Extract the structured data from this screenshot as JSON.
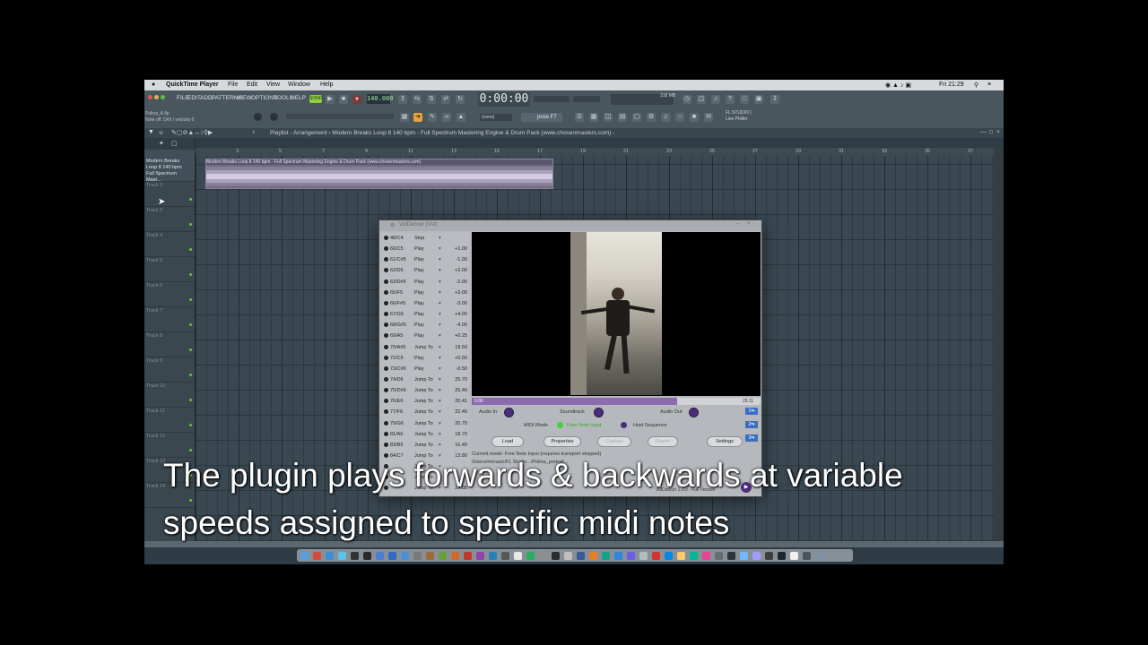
{
  "menubar": {
    "app_name": "QuickTime Player",
    "items": [
      "File",
      "Edit",
      "View",
      "Window",
      "Help"
    ],
    "clock": "Fri 21:29"
  },
  "fl": {
    "menus": [
      "FILE",
      "EDIT",
      "ADD",
      "PATTERNS",
      "VIEW",
      "OPTIONS",
      "TOOLS",
      "HELP"
    ],
    "tempo": "140.000",
    "time": "0:00:00",
    "project_name": "Polina_A.flp",
    "hint": "Note off: D#5 / velocity 0",
    "pattern": "(none)",
    "preset": "pose F7",
    "branding": "FL STUDIO |",
    "branding2": "Live Philler",
    "memory": "318 MB"
  },
  "playlist": {
    "title": "Playlist - Arrangement › Modern Breaks Loop 8 140 bpm - Full Spectrum Mastering Engine & Drum Pack (www.chosenmasters.com) -",
    "clip_label": "Modern Breaks Loop 8 140 bpm - Full Spectrum Mastering Engine & Drum Pack (www.chosenmasters.com)",
    "first_track": "Modern Breaks Loop 8 140 bpm Full Spectrum Mast...",
    "tracks": [
      "Track 2",
      "Track 3",
      "Track 4",
      "Track 5",
      "Track 6",
      "Track 7",
      "Track 8",
      "Track 9",
      "Track 10",
      "Track 11",
      "Track 12",
      "Track 13",
      "Track 14"
    ],
    "ruler": [
      "3",
      "5",
      "7",
      "9",
      "11",
      "13",
      "15",
      "17",
      "19",
      "21",
      "23",
      "25",
      "27",
      "29",
      "31",
      "33",
      "35",
      "37"
    ]
  },
  "plugin": {
    "title": "VidDancer (Vst)",
    "notes": [
      {
        "note": "48/C4",
        "mode": "Stop",
        "value": ""
      },
      {
        "note": "60/C5",
        "mode": "Play",
        "value": "+1.00"
      },
      {
        "note": "61/C#5",
        "mode": "Play",
        "value": "-1.00"
      },
      {
        "note": "62/D5",
        "mode": "Play",
        "value": "+2.00"
      },
      {
        "note": "63/D#5",
        "mode": "Play",
        "value": "-2.00"
      },
      {
        "note": "65/F5",
        "mode": "Play",
        "value": "+3.00"
      },
      {
        "note": "66/F#5",
        "mode": "Play",
        "value": "-3.00"
      },
      {
        "note": "67/G5",
        "mode": "Play",
        "value": "+4.00"
      },
      {
        "note": "68/G#5",
        "mode": "Play",
        "value": "-4.00"
      },
      {
        "note": "69/A5",
        "mode": "Play",
        "value": "+0.25"
      },
      {
        "note": "70/A#5",
        "mode": "Jump To",
        "value": "19.50"
      },
      {
        "note": "72/C6",
        "mode": "Play",
        "value": "+0.50"
      },
      {
        "note": "73/C#6",
        "mode": "Play",
        "value": "-0.50"
      },
      {
        "note": "74/D6",
        "mode": "Jump To",
        "value": "25.70"
      },
      {
        "note": "75/D#6",
        "mode": "Jump To",
        "value": "25.40"
      },
      {
        "note": "76/E6",
        "mode": "Jump To",
        "value": "20.41"
      },
      {
        "note": "77/F6",
        "mode": "Jump To",
        "value": "22.40"
      },
      {
        "note": "79/G6",
        "mode": "Jump To",
        "value": "20.70"
      },
      {
        "note": "81/A6",
        "mode": "Jump To",
        "value": "18.70"
      },
      {
        "note": "83/B6",
        "mode": "Jump To",
        "value": "16.40"
      },
      {
        "note": "84/C7",
        "mode": "Jump To",
        "value": "13.80"
      },
      {
        "note": "",
        "mode": "Jump To",
        "value": ""
      },
      {
        "note": "",
        "mode": "Jump To",
        "value": ""
      },
      {
        "note": "",
        "mode": "Jump To",
        "value": "29.08"
      }
    ],
    "position_label": "0.00",
    "end_label": "29.11",
    "progress_fraction": 0.71,
    "audio_in": "Audio In",
    "soundtrack": "Soundtrack",
    "audio_out": "Audio Out",
    "midi_mode": "MIDI Mode",
    "free_note_input": "Free Note Input",
    "host_sequence": "Host Sequence",
    "buttons": {
      "load": "Load",
      "properties": "Properties",
      "capture": "Capture",
      "export": "Export",
      "settings": "Settings"
    },
    "side_buttons": [
      "1⇆",
      "2⇆",
      "3⇆"
    ],
    "status_line": "Current mode: Free Note Input (requires transport stopped)",
    "path_line": "/Users/mmusic/FL Studio.../Polina_portrait...",
    "version": "VidDancer 1.0.0 - Full Version"
  },
  "caption": {
    "line1": "The plugin plays forwards & backwards at variable",
    "line2": "speeds assigned to specific midi notes"
  }
}
